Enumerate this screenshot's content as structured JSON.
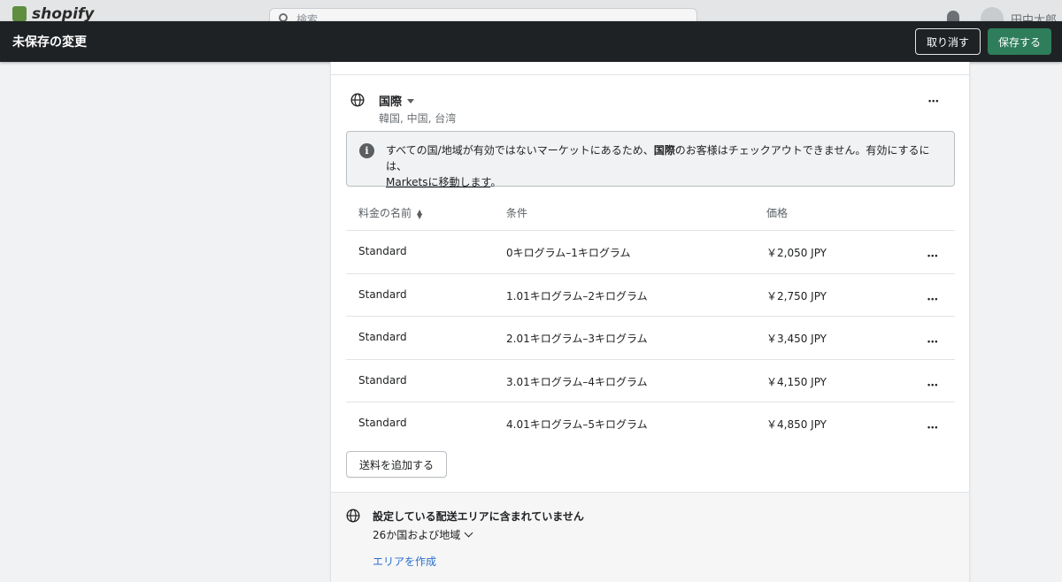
{
  "topbar": {
    "logo_text": "shopify",
    "search_placeholder": "検索",
    "user_name": "田中太郎"
  },
  "savebar": {
    "title": "未保存の変更",
    "discard_label": "取り消す",
    "save_label": "保存する"
  },
  "zone": {
    "name": "国際",
    "countries": "韓国, 中国, 台湾"
  },
  "banner": {
    "text_before": "すべての国/地域が有効ではないマーケットにあるため、",
    "text_bold": "国際",
    "text_after": "のお客様はチェックアウトできません。有効にするには、",
    "link_text": "Marketsに移動します",
    "text_end": "。"
  },
  "rates_table": {
    "headers": [
      "料金の名前",
      "条件",
      "価格"
    ],
    "rows": [
      {
        "name": "Standard",
        "condition": "0キログラム–1キログラム",
        "price": "￥2,050 JPY"
      },
      {
        "name": "Standard",
        "condition": "1.01キログラム–2キログラム",
        "price": "￥2,750 JPY"
      },
      {
        "name": "Standard",
        "condition": "2.01キログラム–3キログラム",
        "price": "￥3,450 JPY"
      },
      {
        "name": "Standard",
        "condition": "3.01キログラム–4キログラム",
        "price": "￥4,150 JPY"
      },
      {
        "name": "Standard",
        "condition": "4.01キログラム–5キログラム",
        "price": "￥4,850 JPY"
      }
    ]
  },
  "add_rate_label": "送料を追加する",
  "not_covered": {
    "title": "設定している配送エリアに含まれていません",
    "count": "26か国および地域",
    "create_link": "エリアを作成"
  },
  "colors": {
    "save_bar_bg": "#1f2225",
    "save_button": "#2e7d5b",
    "link": "#2c6ecb"
  }
}
